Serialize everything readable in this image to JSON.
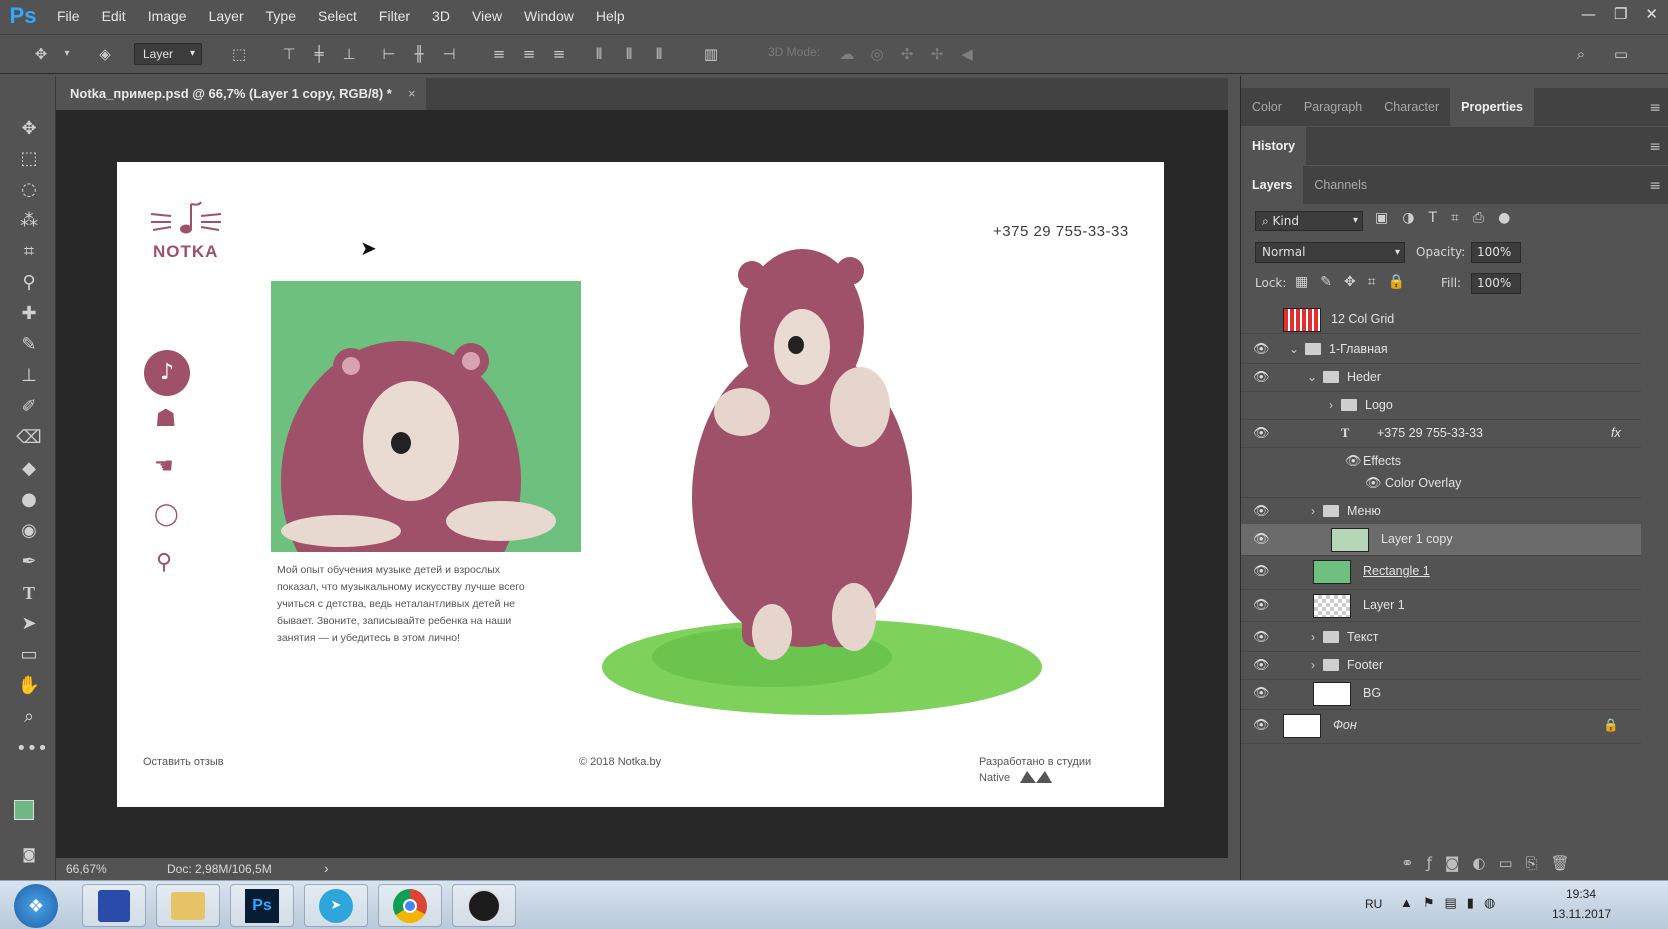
{
  "app": {
    "logo": "Ps"
  },
  "menu": [
    "File",
    "Edit",
    "Image",
    "Layer",
    "Type",
    "Select",
    "Filter",
    "3D",
    "View",
    "Window",
    "Help"
  ],
  "window_controls": [
    "minimize-icon",
    "restore-icon",
    "close-icon"
  ],
  "options": {
    "layer_select": "Layer",
    "mode3d_label": "3D Mode:"
  },
  "document_tab": {
    "title": "Notka_пример.psd @ 66,7% (Layer 1 copy, RGB/8) *",
    "close": "×"
  },
  "status": {
    "zoom": "66,67%",
    "doc": "Doc: 2,98M/106,5M",
    "arrow": "›"
  },
  "artboard": {
    "logo_text": "NOTKA",
    "phone": "+375 29 755-33-33",
    "body_text": "Мой опыт обучения музыке детей и взрослых показал, что музыкальному искусству лучше всего учиться с детства, ведь неталантливых детей не бывает. Звоните, записывайте ребенка на наши занятия — и убедитесь в этом лично!",
    "footer_left": "Оставить отзыв",
    "footer_center": "© 2018 Notka.by",
    "footer_right_line1": "Разработано в студии",
    "footer_right_line2": "Native",
    "accent": "#a0516a",
    "green": "#6ec07e"
  },
  "panels": {
    "top_tabs": [
      "Color",
      "Paragraph",
      "Character",
      "Properties"
    ],
    "history_tab": "History",
    "layers_tabs": [
      "Layers",
      "Channels"
    ],
    "kind": "Kind",
    "blend_mode": "Normal",
    "opacity_label": "Opacity:",
    "opacity_value": "100%",
    "lock_label": "Lock:",
    "fill_label": "Fill:",
    "fill_value": "100%"
  },
  "layers": [
    {
      "name": "12 Col Grid"
    },
    {
      "name": "1-Главная"
    },
    {
      "name": "Heder"
    },
    {
      "name": "Logo"
    },
    {
      "name": "+375 29 755-33-33",
      "fx": "fx"
    },
    {
      "name": "Effects"
    },
    {
      "name": "Color Overlay"
    },
    {
      "name": "Меню"
    },
    {
      "name": "Layer 1 copy"
    },
    {
      "name": "Rectangle 1"
    },
    {
      "name": "Layer 1"
    },
    {
      "name": "Текст"
    },
    {
      "name": "Footer"
    },
    {
      "name": "BG"
    },
    {
      "name": "Фон"
    }
  ],
  "taskbar": {
    "lang": "RU",
    "time": "19:34",
    "date": "13.11.2017"
  }
}
